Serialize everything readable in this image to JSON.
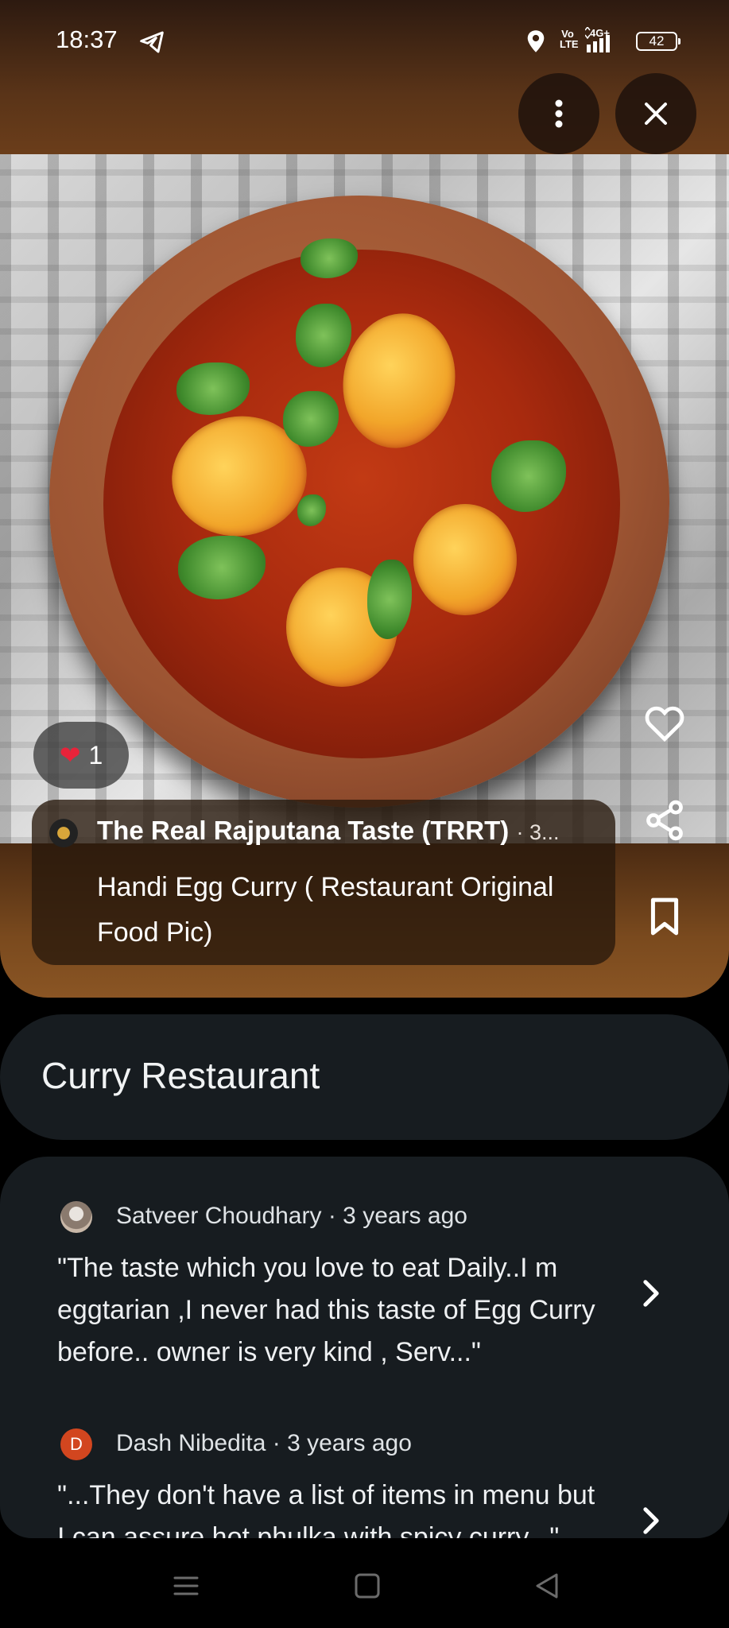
{
  "status_bar": {
    "time": "18:37",
    "volte": "Vo LTE",
    "network": "4G+",
    "battery": "42",
    "icons": [
      "telegram-icon",
      "location-icon",
      "signal-icon",
      "battery-icon"
    ]
  },
  "top_actions": {
    "more_icon": "more-vertical-icon",
    "close_icon": "close-icon"
  },
  "photo": {
    "like_count": "1",
    "poster_name": "The Real Rajputana Taste (TRRT)",
    "poster_meta": "· 3...",
    "caption": "Handi Egg Curry ( Restaurant Original Food Pic)",
    "side_actions": [
      "heart-outline-icon",
      "share-icon",
      "bookmark-icon"
    ]
  },
  "place": {
    "name": "Curry Restaurant"
  },
  "reviews": [
    {
      "author": "Satveer Choudhary",
      "time": "· 3 years ago",
      "text": "\"The taste which you love to eat Daily..I m eggtarian ,I never had this taste of Egg Curry before.. owner is very kind , Serv...\""
    },
    {
      "author": "Dash Nibedita",
      "avatar_letter": "D",
      "time": "· 3 years ago",
      "text": "\"...They don't have a list of items in menu but I can assure hot phulka with spicy curry...\""
    }
  ],
  "nav": {
    "items": [
      "menu-icon",
      "home-icon",
      "back-icon"
    ]
  },
  "colors": {
    "background": "#000000",
    "card": "#171c20",
    "media_brown": "#6a3d1a",
    "like_red": "#e8233a",
    "review_avatar_d": "#d2461f"
  }
}
